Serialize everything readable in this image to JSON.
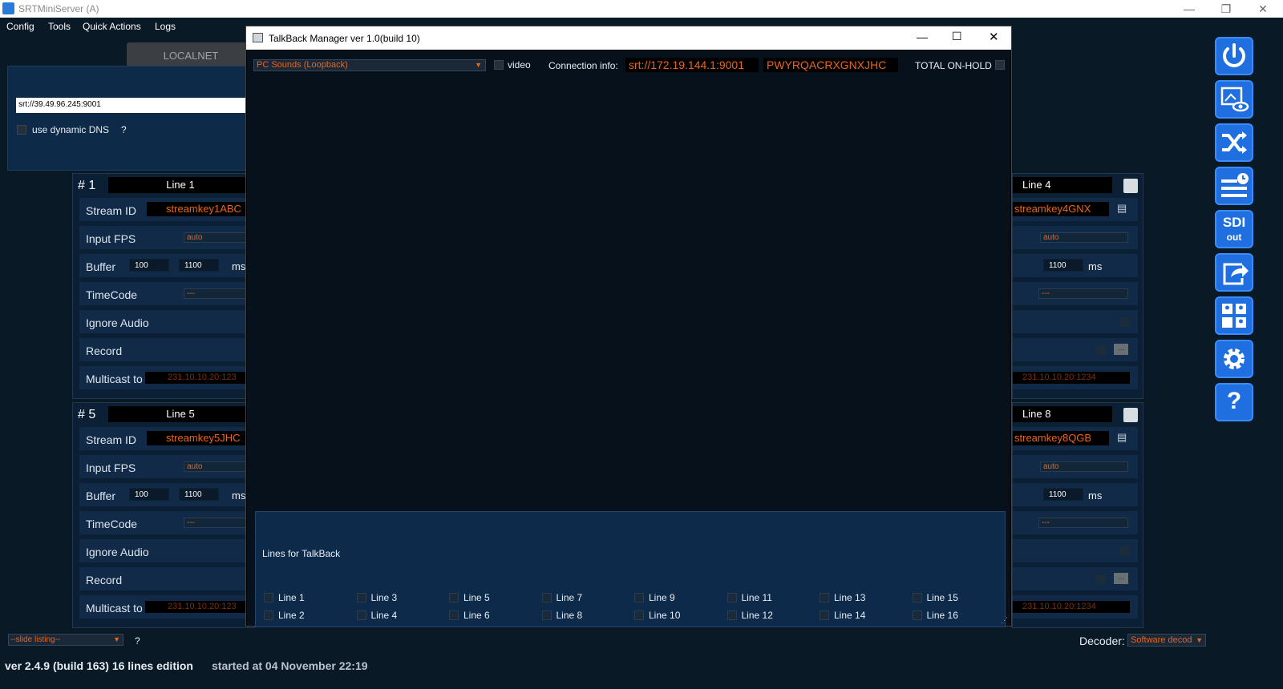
{
  "window": {
    "title": "SRTMiniServer (A)",
    "minimize": "—",
    "restore": "❐",
    "close": "✕"
  },
  "menu": [
    "Config",
    "Tools",
    "Quick Actions",
    "Logs"
  ],
  "network": {
    "tab_label": "LOCALNET",
    "srt_url": "srt://39.49.96.245:9001",
    "dns_label": "use dynamic DNS",
    "dns_help": "?"
  },
  "groups": [
    {
      "num": "# 1",
      "name": "Line 1",
      "stream_id": "streamkey1ABC",
      "fps": "auto",
      "buf1": "100",
      "buf2": "1100",
      "timecode": "---",
      "multicast": "231.10.10.20:123"
    },
    {
      "num": "# 5",
      "name": "Line 5",
      "stream_id": "streamkey5JHC",
      "fps": "auto",
      "buf1": "100",
      "buf2": "1100",
      "timecode": "---",
      "multicast": "231.10.10.20:123"
    }
  ],
  "right_groups": [
    {
      "name": "Line 4",
      "stream_id": "streamkey4GNX",
      "fps": "auto",
      "buf": "1100",
      "unit": "ms",
      "timecode": "---",
      "multicast": "231.10.10.20:1234"
    },
    {
      "name": "Line 8",
      "stream_id": "streamkey8QGB",
      "fps": "auto",
      "buf": "1100",
      "unit": "ms",
      "timecode": "---",
      "multicast": "231.10.10.20:1234"
    }
  ],
  "labels": {
    "stream_id": "Stream ID",
    "input_fps": "Input FPS",
    "buffer": "Buffer",
    "ms": "ms",
    "timecode": "TimeCode",
    "ignore_audio": "Ignore Audio",
    "record": "Record",
    "multicast": "Multicast to"
  },
  "talkback": {
    "title": "TalkBack Manager    ver 1.0(build 10)",
    "source": "PC Sounds (Loopback)",
    "video_label": "video",
    "conn_label": "Connection info:",
    "conn_url": "srt://172.19.144.1:9001",
    "conn_key": "PWYRQACRXGNXJHC",
    "total_onhold": "TOTAL ON-HOLD",
    "lines_title": "Lines for TalkBack",
    "lines": [
      "Line 1",
      "Line 2",
      "Line 3",
      "Line 4",
      "Line 5",
      "Line 6",
      "Line 7",
      "Line 8",
      "Line 9",
      "Line 10",
      "Line 11",
      "Line 12",
      "Line 13",
      "Line 14",
      "Line 15",
      "Line 16"
    ]
  },
  "bottom": {
    "slide": "--slide listing--",
    "help": "?",
    "decoder_label": "Decoder:",
    "decoder_value": "Software decod",
    "version": "ver 2.4.9 (build 163) 16 lines edition",
    "started": "started at 04 November 22:19"
  },
  "toolbar": {
    "sdi_top": "SDI",
    "sdi_bottom": "out",
    "help": "?"
  },
  "colors": {
    "accent_orange": "#e8651c",
    "toolbar_blue": "#1f6fe0",
    "panel_blue": "#0e2a4a"
  }
}
